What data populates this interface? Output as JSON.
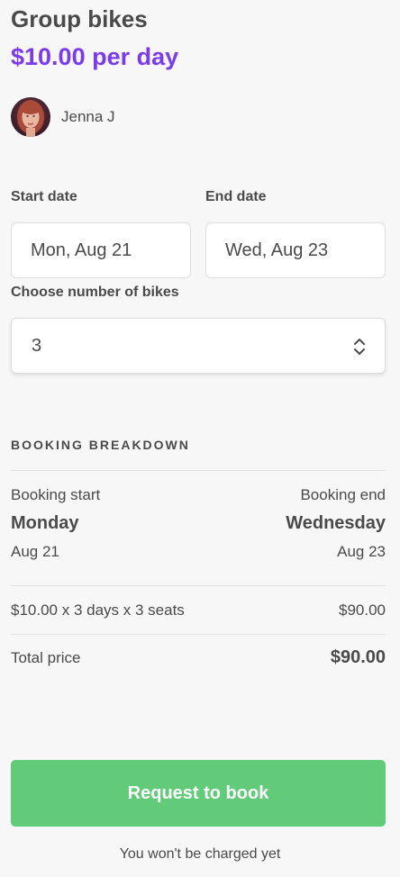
{
  "listing": {
    "title": "Group bikes",
    "price_label": "$10.00 per day"
  },
  "author": {
    "name": "Jenna J"
  },
  "form": {
    "start_date_label": "Start date",
    "start_date_value": "Mon, Aug 21",
    "end_date_label": "End date",
    "end_date_value": "Wed, Aug 23",
    "bikes_label": "Choose number of bikes",
    "bikes_value": "3"
  },
  "breakdown": {
    "heading": "BOOKING BREAKDOWN",
    "start_label": "Booking start",
    "start_day": "Monday",
    "start_date": "Aug 21",
    "end_label": "Booking end",
    "end_day": "Wednesday",
    "end_date": "Aug 23",
    "line_item_label": "$10.00 x 3 days x 3 seats",
    "line_item_value": "$90.00",
    "total_label": "Total price",
    "total_value": "$90.00"
  },
  "actions": {
    "book_label": "Request to book",
    "charge_note": "You won't be charged yet"
  },
  "colors": {
    "price_accent": "#7c3aed",
    "button_green": "#61cb7a",
    "background": "#f7f7f8"
  },
  "icons": {
    "avatar": "user-avatar-photo",
    "stepper": "chevron-up-down-icon"
  }
}
